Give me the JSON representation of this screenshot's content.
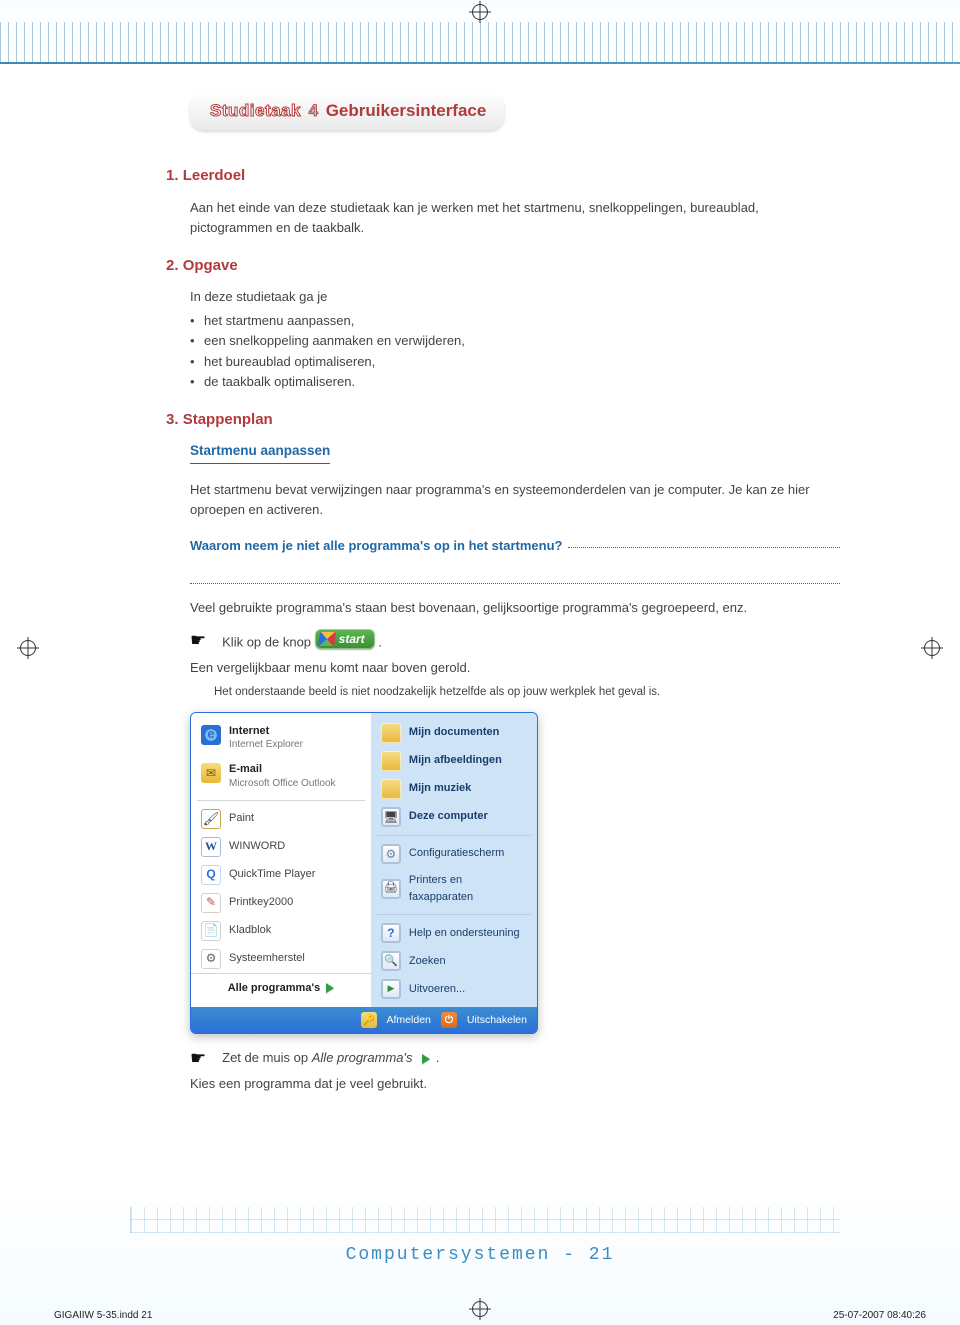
{
  "pill": {
    "prefix": "Studietaak",
    "num": "4",
    "title": "Gebruikersinterface"
  },
  "h1": {
    "num": "1.",
    "text": "Leerdoel"
  },
  "p1": "Aan het einde van deze studietaak kan je werken met het startmenu, snelkoppelingen, bureaublad, pictogrammen en de taakbalk.",
  "h2": {
    "num": "2.",
    "text": "Opgave"
  },
  "p2_intro": "In deze studietaak ga je",
  "p2_items": [
    "het startmenu aanpassen,",
    "een snelkoppeling aanmaken en verwijderen,",
    "het bureaublad optimaliseren,",
    "de taakbalk optimaliseren."
  ],
  "h3": {
    "num": "3.",
    "text": "Stappenplan"
  },
  "sub1": "Startmenu aanpassen",
  "p3": "Het startmenu bevat verwijzingen naar programma's en systeemonderdelen van je computer. Je kan ze hier oproepen en activeren.",
  "question": "Waarom neem je niet alle programma's op in het startmenu?",
  "answer_help": "Veel gebruikte programma's staan best bovenaan, gelijksoortige programma's gegroepeerd, enz.",
  "step1_a": "Klik op de knop",
  "step1_b": ".",
  "start_label": "start",
  "p4": "Een vergelijkbaar menu komt naar boven gerold.",
  "note": "Het onderstaande beeld is niet noodzakelijk hetzelfde als op jouw werkplek het geval is.",
  "startmenu": {
    "left": [
      {
        "ic": "ie",
        "t": "Internet",
        "s": "Internet Explorer"
      },
      {
        "ic": "mail",
        "t": "E-mail",
        "s": "Microsoft Office Outlook"
      },
      {
        "sep": true
      },
      {
        "ic": "paint",
        "t": "Paint"
      },
      {
        "ic": "word",
        "t": "WINWORD"
      },
      {
        "ic": "qt",
        "t": "QuickTime Player"
      },
      {
        "ic": "pk",
        "t": "Printkey2000"
      },
      {
        "ic": "note",
        "t": "Kladblok"
      },
      {
        "ic": "sys",
        "t": "Systeemherstel"
      }
    ],
    "all": "Alle programma's",
    "right": [
      {
        "ic": "doc",
        "t": "Mijn documenten",
        "bold": true
      },
      {
        "ic": "doc",
        "t": "Mijn afbeeldingen",
        "bold": true
      },
      {
        "ic": "doc",
        "t": "Mijn muziek",
        "bold": true
      },
      {
        "ic": "pc",
        "t": "Deze computer",
        "bold": true,
        "alt": true
      },
      {
        "sep": true
      },
      {
        "ic": "cfg",
        "t": "Configuratiescherm",
        "alt": true
      },
      {
        "ic": "prn",
        "t": "Printers en faxapparaten",
        "alt": true
      },
      {
        "sep": true
      },
      {
        "ic": "help",
        "t": "Help en ondersteuning",
        "alt": true
      },
      {
        "ic": "search",
        "t": "Zoeken",
        "alt": true
      },
      {
        "ic": "run",
        "t": "Uitvoeren...",
        "alt": true
      }
    ],
    "footer": {
      "logoff": "Afmelden",
      "shutdown": "Uitschakelen"
    }
  },
  "step2_a": "Zet de muis op ",
  "step2_it": "Alle programma's",
  "step2_b": ".",
  "p5": "Kies een programma dat je veel gebruikt.",
  "footer_title": "Computersystemen - 21",
  "indd": "GIGAIIW 5-35.indd   21",
  "indd_r": "25-07-2007   08:40:26"
}
